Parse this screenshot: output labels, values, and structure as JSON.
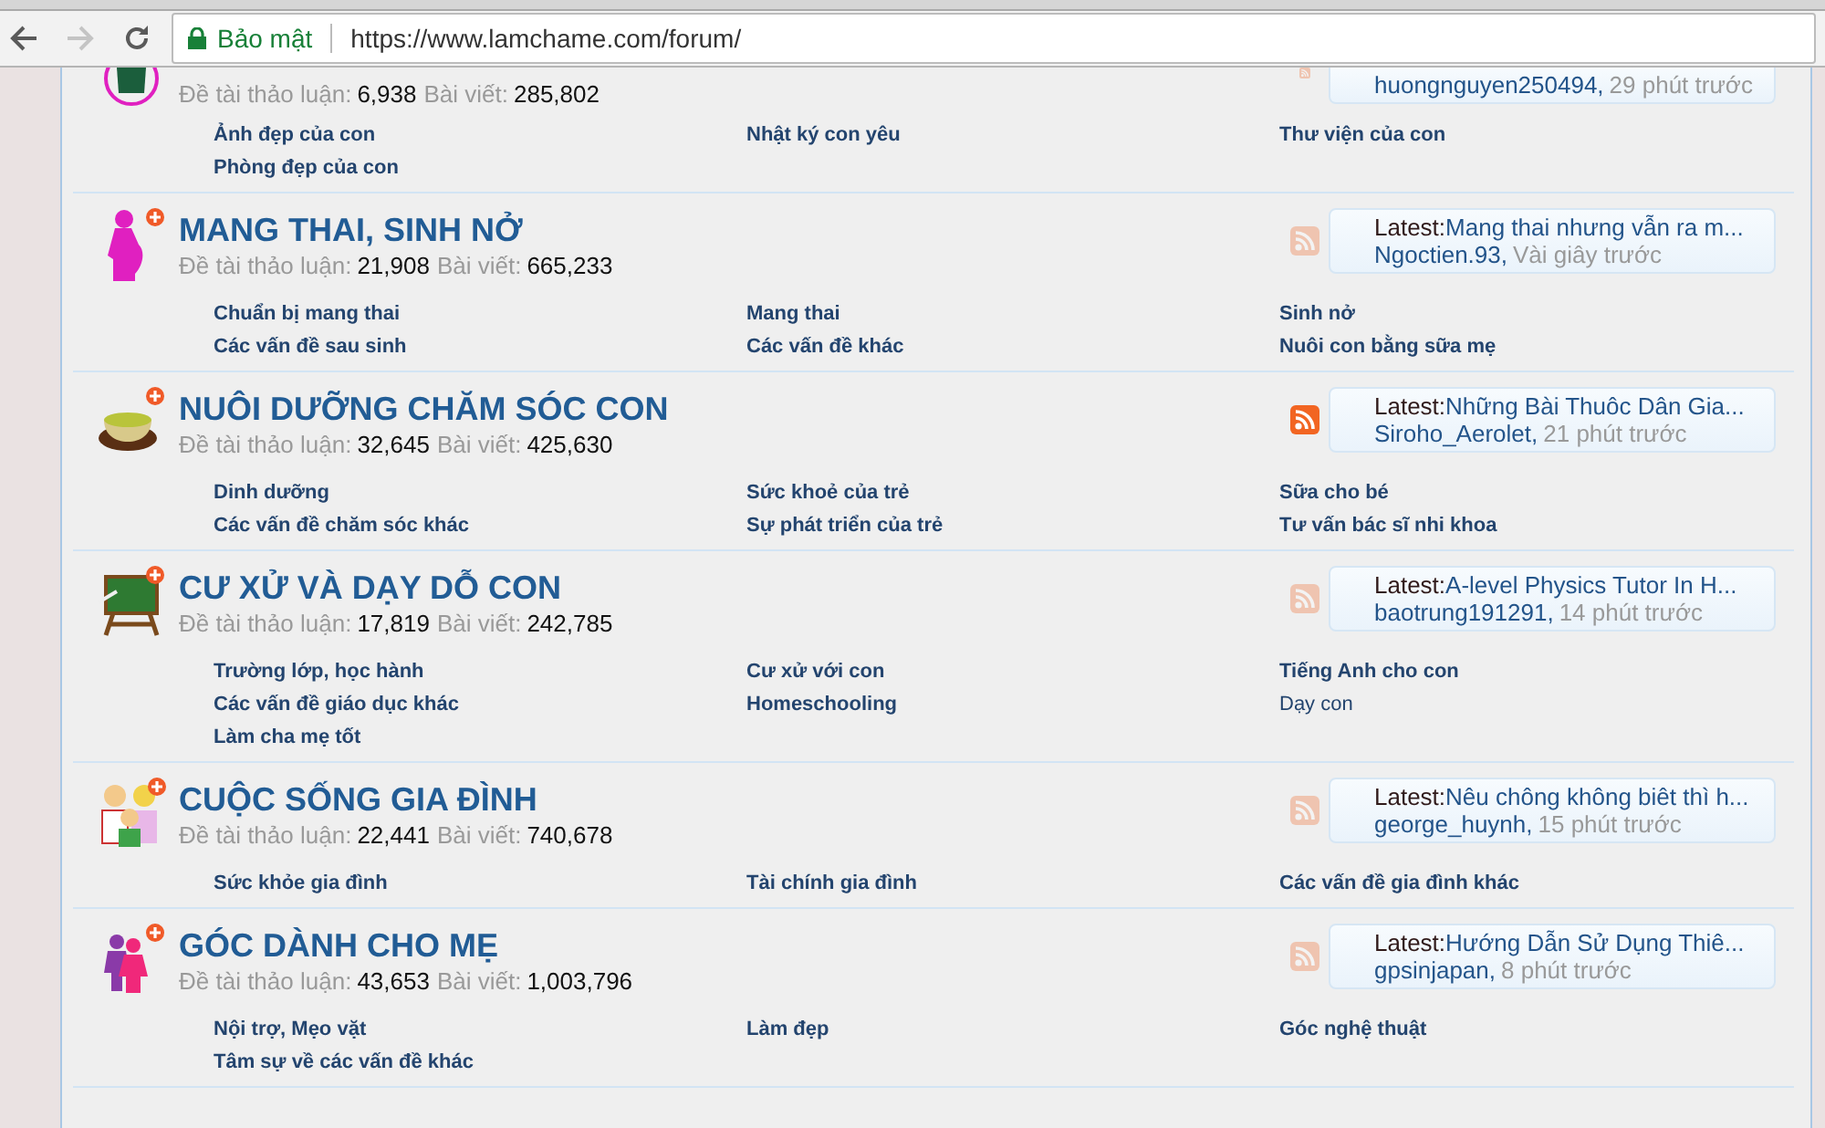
{
  "browser": {
    "back_disabled": false,
    "forward_disabled": true,
    "security_label": "Bảo mật",
    "url": "https://www.lamchame.com/forum/"
  },
  "forums": [
    {
      "discussions_label": "Đề tài thảo luận:",
      "discussions": "6,938",
      "posts_label": "Bài viết:",
      "posts": "285,802",
      "feed_active": false,
      "latest": {
        "user": "huongnguyen250494,",
        "time": "29 phút trước"
      },
      "subforums": [
        {
          "text": "Ảnh đẹp của con",
          "bold": true
        },
        {
          "text": "Nhật ký con yêu",
          "bold": true
        },
        {
          "text": "Thư viện của con",
          "bold": true
        },
        {
          "text": "Phòng đẹp của con",
          "bold": true
        }
      ]
    },
    {
      "title": "MANG THAI, SINH NỞ",
      "discussions_label": "Đề tài thảo luận:",
      "discussions": "21,908",
      "posts_label": "Bài viết:",
      "posts": "665,233",
      "feed_active": false,
      "latest": {
        "label": "Latest:",
        "title": "Mang thai nhưng vẫn ra m...",
        "user": "Ngoctien.93,",
        "time": "Vài giây trước"
      },
      "subforums": [
        {
          "text": "Chuẩn bị mang thai",
          "bold": true
        },
        {
          "text": "Mang thai",
          "bold": true
        },
        {
          "text": "Sinh nở",
          "bold": true
        },
        {
          "text": "Các vấn đề sau sinh",
          "bold": true
        },
        {
          "text": "Các vấn đề khác",
          "bold": true
        },
        {
          "text": "Nuôi con bằng sữa mẹ",
          "bold": true
        }
      ]
    },
    {
      "title": "NUÔI DƯỠNG CHĂM SÓC CON",
      "discussions_label": "Đề tài thảo luận:",
      "discussions": "32,645",
      "posts_label": "Bài viết:",
      "posts": "425,630",
      "feed_active": true,
      "latest": {
        "label": "Latest:",
        "title": "Những Bài Thuôc Dân Gia...",
        "user": "Siroho_Aerolet,",
        "time": "21 phút trước"
      },
      "subforums": [
        {
          "text": "Dinh dưỡng",
          "bold": true
        },
        {
          "text": "Sức khoẻ của trẻ",
          "bold": true
        },
        {
          "text": "Sữa cho bé",
          "bold": true
        },
        {
          "text": "Các vấn đề chăm sóc khác",
          "bold": true
        },
        {
          "text": "Sự phát triển của trẻ",
          "bold": true
        },
        {
          "text": "Tư vấn bác sĩ nhi khoa",
          "bold": true
        }
      ]
    },
    {
      "title": "CƯ XỬ VÀ DẠY DỖ CON",
      "discussions_label": "Đề tài thảo luận:",
      "discussions": "17,819",
      "posts_label": "Bài viết:",
      "posts": "242,785",
      "feed_active": false,
      "latest": {
        "label": "Latest:",
        "title": "A-level Physics Tutor In H...",
        "user": "baotrung191291,",
        "time": "14 phút trước"
      },
      "subforums": [
        {
          "text": "Trường lớp, học hành",
          "bold": true
        },
        {
          "text": "Cư xử với con",
          "bold": true
        },
        {
          "text": "Tiếng Anh cho con",
          "bold": true
        },
        {
          "text": "Các vấn đề giáo dục khác",
          "bold": true
        },
        {
          "text": "Homeschooling",
          "bold": true
        },
        {
          "text": "Dạy con",
          "bold": false
        },
        {
          "text": "Làm cha mẹ tốt",
          "bold": true
        }
      ]
    },
    {
      "title": "CUỘC SỐNG GIA ĐÌNH",
      "discussions_label": "Đề tài thảo luận:",
      "discussions": "22,441",
      "posts_label": "Bài viết:",
      "posts": "740,678",
      "feed_active": false,
      "latest": {
        "label": "Latest:",
        "title": "Nêu chông không biêt thì h...",
        "user": "george_huynh,",
        "time": "15 phút trước"
      },
      "subforums": [
        {
          "text": "Sức khỏe gia đình",
          "bold": true
        },
        {
          "text": "Tài chính gia đình",
          "bold": true
        },
        {
          "text": "Các vấn đề gia đình khác",
          "bold": true
        }
      ]
    },
    {
      "title": "GÓC DÀNH CHO MẸ",
      "discussions_label": "Đề tài thảo luận:",
      "discussions": "43,653",
      "posts_label": "Bài viết:",
      "posts": "1,003,796",
      "feed_active": false,
      "latest": {
        "label": "Latest:",
        "title": "Hướng Dẫn Sử Dụng Thiê...",
        "user": "gpsinjapan,",
        "time": "8 phút trước"
      },
      "subforums": [
        {
          "text": "Nội trợ, Mẹo vặt",
          "bold": true
        },
        {
          "text": "Làm đẹp",
          "bold": true
        },
        {
          "text": "Góc nghệ thuật",
          "bold": true
        },
        {
          "text": "Tâm sự về các vấn đề khác",
          "bold": true
        }
      ]
    }
  ]
}
